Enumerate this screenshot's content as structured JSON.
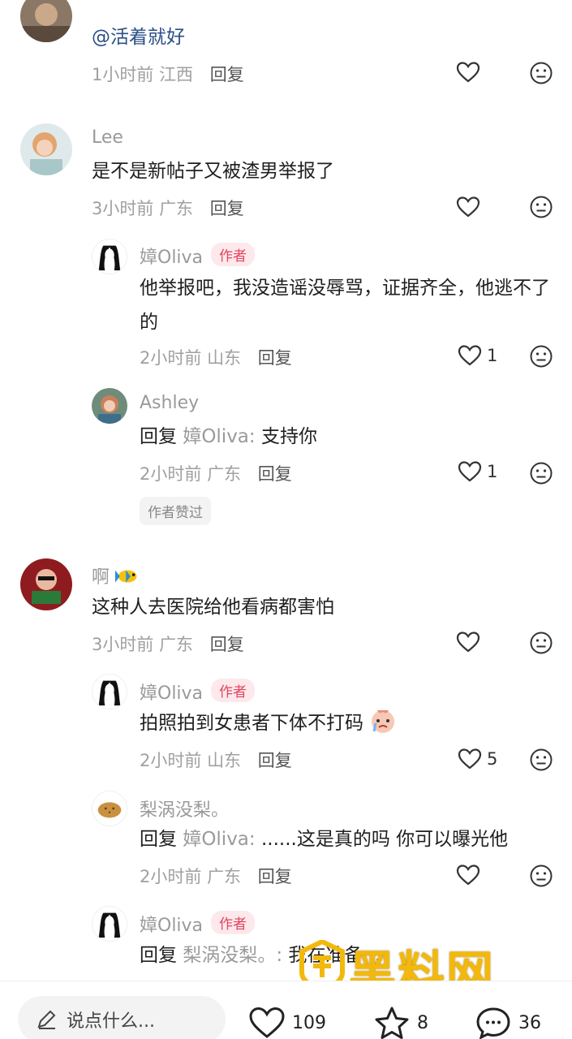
{
  "comments": [
    {
      "id": "c0",
      "name": "",
      "content": "@活着就好",
      "time": "1小时前",
      "location": "江西",
      "reply_label": "回复",
      "likes": ""
    },
    {
      "id": "c1",
      "name": "Lee",
      "content": "是不是新帖子又被渣男举报了",
      "time": "3小时前",
      "location": "广东",
      "reply_label": "回复",
      "likes": ""
    },
    {
      "id": "r1",
      "name": "嫜Oliva",
      "author_tag": "作者",
      "content": "他举报吧，我没造谣没辱骂，证据齐全，他逃不了的",
      "time": "2小时前",
      "location": "山东",
      "reply_label": "回复",
      "likes": "1"
    },
    {
      "id": "r2",
      "name": "Ashley",
      "reply_prefix": "回复",
      "reply_to": "嫜Oliva:",
      "content": "支持你",
      "time": "2小时前",
      "location": "广东",
      "reply_label": "回复",
      "likes": "1",
      "liked_badge": "作者赞过"
    },
    {
      "id": "c2",
      "name": "啊",
      "content": "这种人去医院给他看病都害怕",
      "time": "3小时前",
      "location": "广东",
      "reply_label": "回复",
      "likes": ""
    },
    {
      "id": "r3",
      "name": "嫜Oliva",
      "author_tag": "作者",
      "content": "拍照拍到女患者下体不打码",
      "time": "2小时前",
      "location": "山东",
      "reply_label": "回复",
      "likes": "5"
    },
    {
      "id": "r4",
      "name": "梨涡没梨。",
      "reply_prefix": "回复",
      "reply_to": "嫜Oliva:",
      "content": "......这是真的吗 你可以曝光他",
      "time": "2小时前",
      "location": "广东",
      "reply_label": "回复",
      "likes": ""
    },
    {
      "id": "r5",
      "name": "嫜Oliva",
      "author_tag": "作者",
      "reply_prefix": "回复",
      "reply_to": "梨涡没梨。:",
      "content": "我在准备..."
    }
  ],
  "bottom_bar": {
    "input_placeholder": "说点什么...",
    "like_count": "109",
    "star_count": "8",
    "comment_count": "36"
  },
  "watermark": {
    "title": "黑料网",
    "url": "https://hlwf4.com"
  },
  "colors": {
    "author_tag_text": "#e0465e",
    "author_tag_bg": "#fde8ec",
    "watermark": "#f2b90c"
  }
}
